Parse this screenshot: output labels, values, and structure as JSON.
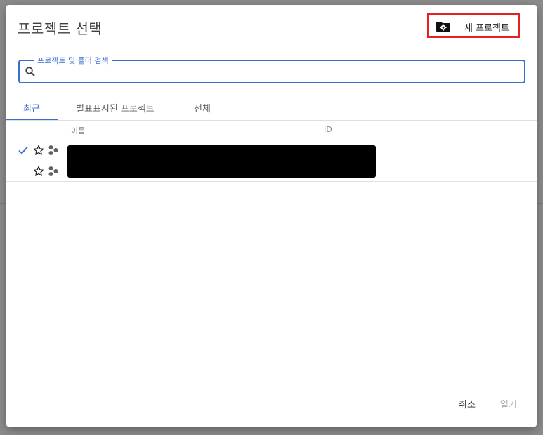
{
  "dialog": {
    "title": "프로젝트 선택",
    "new_project_label": "새 프로젝트"
  },
  "search": {
    "legend": "프로젝트 및 폴더 검색",
    "value": "",
    "placeholder": ""
  },
  "tabs": [
    {
      "label": "최근",
      "active": true
    },
    {
      "label": "별표표시된 프로젝트",
      "active": false
    },
    {
      "label": "전체",
      "active": false
    }
  ],
  "table": {
    "columns": [
      "이름",
      "ID"
    ],
    "rows": [
      {
        "selected": true,
        "starred": false
      },
      {
        "selected": false,
        "starred": false
      }
    ]
  },
  "footer": {
    "cancel_label": "취소",
    "open_label": "열기"
  },
  "colors": {
    "accent": "#3a6fd1",
    "highlight_border": "#e32222",
    "disabled_text": "#b0b0b0"
  }
}
